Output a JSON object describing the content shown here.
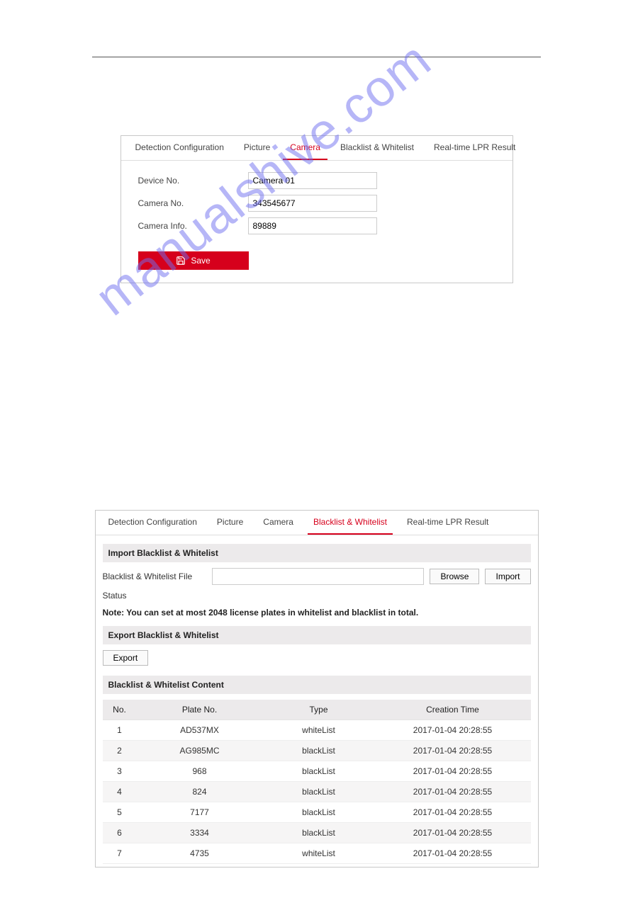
{
  "watermark": "manualshive.com",
  "panel1": {
    "tabs": {
      "detection": "Detection Configuration",
      "picture": "Picture",
      "camera": "Camera",
      "blackwhite": "Blacklist & Whitelist",
      "realtime": "Real-time LPR Result"
    },
    "fields": {
      "device_no_label": "Device No.",
      "device_no_value": "Camera 01",
      "camera_no_label": "Camera No.",
      "camera_no_value": "343545677",
      "camera_info_label": "Camera Info.",
      "camera_info_value": "89889"
    },
    "save_label": "Save"
  },
  "panel2": {
    "tabs": {
      "detection": "Detection Configuration",
      "picture": "Picture",
      "camera": "Camera",
      "blackwhite": "Blacklist & Whitelist",
      "realtime": "Real-time LPR Result"
    },
    "import_header": "Import Blacklist & Whitelist",
    "file_label": "Blacklist & Whitelist File",
    "file_value": "",
    "browse_label": "Browse",
    "import_label": "Import",
    "status_label": "Status",
    "note": "Note: You can set at most 2048 license plates in whitelist and blacklist in total.",
    "export_header": "Export Blacklist & Whitelist",
    "export_label": "Export",
    "content_header": "Blacklist & Whitelist Content",
    "columns": {
      "no": "No.",
      "plate": "Plate No.",
      "type": "Type",
      "time": "Creation Time"
    },
    "rows": [
      {
        "no": "1",
        "plate": "AD537MX",
        "type": "whiteList",
        "time": "2017-01-04 20:28:55"
      },
      {
        "no": "2",
        "plate": "AG985MC",
        "type": "blackList",
        "time": "2017-01-04 20:28:55"
      },
      {
        "no": "3",
        "plate": "968",
        "type": "blackList",
        "time": "2017-01-04 20:28:55"
      },
      {
        "no": "4",
        "plate": "824",
        "type": "blackList",
        "time": "2017-01-04 20:28:55"
      },
      {
        "no": "5",
        "plate": "7177",
        "type": "blackList",
        "time": "2017-01-04 20:28:55"
      },
      {
        "no": "6",
        "plate": "3334",
        "type": "blackList",
        "time": "2017-01-04 20:28:55"
      },
      {
        "no": "7",
        "plate": "4735",
        "type": "whiteList",
        "time": "2017-01-04 20:28:55"
      }
    ]
  }
}
